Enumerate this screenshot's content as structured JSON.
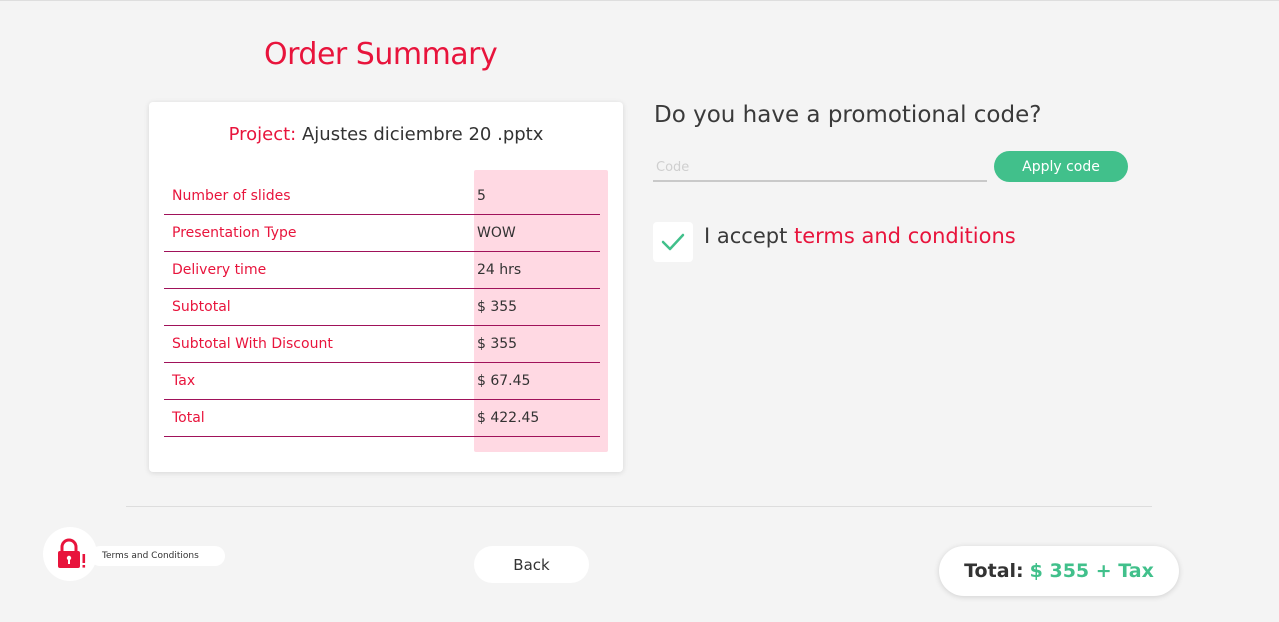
{
  "page": {
    "title": "Order Summary"
  },
  "summary": {
    "project_label": "Project:",
    "project_name": "Ajustes diciembre 20 .pptx",
    "rows": [
      {
        "label": "Number of slides",
        "value": "5"
      },
      {
        "label": "Presentation Type",
        "value": "WOW"
      },
      {
        "label": "Delivery time",
        "value": "24 hrs"
      },
      {
        "label": "Subtotal",
        "value": "$ 355"
      },
      {
        "label": "Subtotal With Discount",
        "value": "$ 355"
      },
      {
        "label": "Tax",
        "value": "$ 67.45"
      },
      {
        "label": "Total",
        "value": "$ 422.45"
      }
    ]
  },
  "promo": {
    "question": "Do you have a promotional code?",
    "placeholder": "Code",
    "value": "",
    "apply_label": "Apply code"
  },
  "terms": {
    "checked": true,
    "prefix": "I accept",
    "link": "terms and conditions"
  },
  "footer": {
    "tc_label": "Terms and Conditions",
    "back_label": "Back",
    "total_label": "Total:",
    "total_value": "$ 355 + Tax"
  },
  "colors": {
    "accent": "#e8143c",
    "success": "#41c08b",
    "highlight": "#ffd9e3",
    "row_border": "#a0125a",
    "background": "#f4f4f4"
  },
  "icons": {
    "checkbox": "check-icon",
    "terms": "lock-alert-icon"
  }
}
